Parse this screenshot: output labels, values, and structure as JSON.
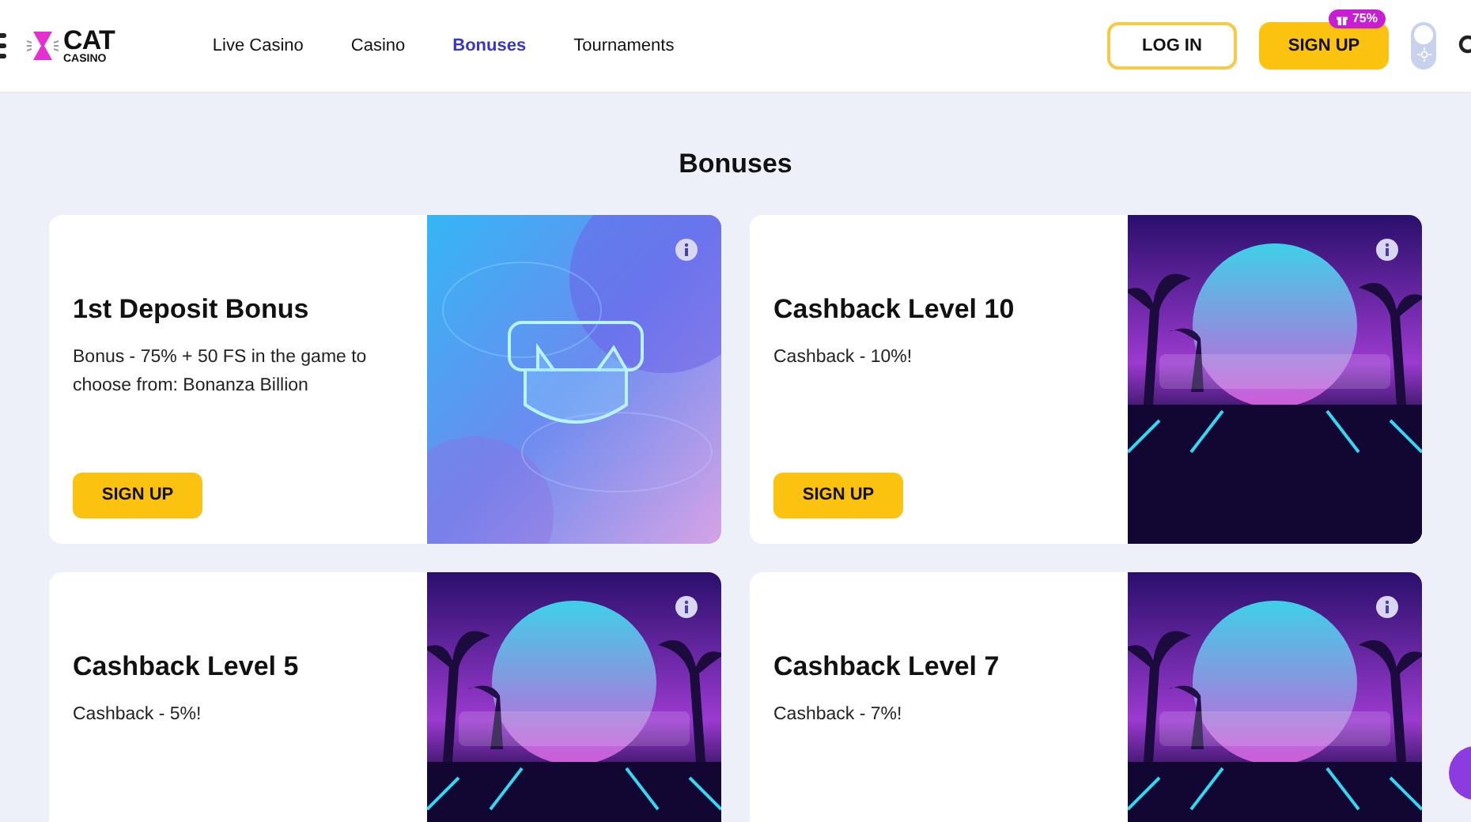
{
  "logo": {
    "top": "CAT",
    "bottom": "CASINO"
  },
  "nav": [
    {
      "label": "Live Casino",
      "selected": false
    },
    {
      "label": "Casino",
      "selected": false
    },
    {
      "label": "Bonuses",
      "selected": true
    },
    {
      "label": "Tournaments",
      "selected": false
    }
  ],
  "login_button": "LOG IN",
  "signup_button": {
    "label": "SIGN UP",
    "badge": "75%"
  },
  "theme_toggle": {
    "on": false
  },
  "page_title": "Bonuses",
  "bonuses": [
    {
      "title": "1st Deposit Bonus",
      "description": "Bonus - 75% + 50 FS in the game to choose from: Bonanza Billion",
      "button": "SIGN UP"
    },
    {
      "title": "Cashback Level 10",
      "description": "Cashback - 10%!",
      "button": "SIGN UP"
    },
    {
      "title": "Cashback Level 5",
      "description": "Cashback - 5%!"
    },
    {
      "title": "Cashback Level 7",
      "description": "Cashback - 7%!"
    }
  ]
}
